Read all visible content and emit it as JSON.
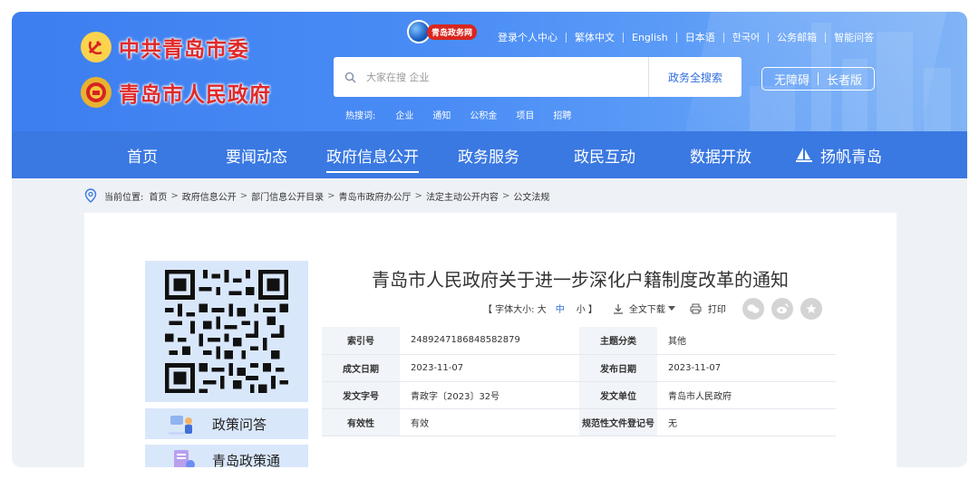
{
  "brand": {
    "party": "中共青岛市委",
    "government": "青岛市人民政府"
  },
  "portal_logo": "青岛政务网",
  "top_links": [
    "登录个人中心",
    "繁体中文",
    "English",
    "日本语",
    "한국어",
    "公务邮箱",
    "智能问答"
  ],
  "search": {
    "placeholder": "大家在搜 企业",
    "button": "政务全搜索"
  },
  "hot_search": {
    "label": "热搜词:",
    "items": [
      "企业",
      "通知",
      "公积金",
      "项目",
      "招聘"
    ]
  },
  "accessibility": {
    "barrier_free": "无障碍",
    "elder": "长者版"
  },
  "nav": [
    "首页",
    "要闻动态",
    "政府信息公开",
    "政务服务",
    "政民互动",
    "数据开放",
    "扬帆青岛"
  ],
  "nav_active": "政府信息公开",
  "breadcrumb": {
    "label": "当前位置:",
    "items": [
      "首页",
      "政府信息公开",
      "部门信息公开目录",
      "青岛市政府办公厅",
      "法定主动公开内容",
      "公文法规"
    ],
    "sep": ">"
  },
  "sidebar": [
    {
      "label": "政策问答",
      "icon": "qa-illustration-icon"
    },
    {
      "label": "青岛政策通",
      "icon": "policy-illustration-icon"
    }
  ],
  "article": {
    "title": "青岛市人民政府关于进一步深化户籍制度改革的通知",
    "font_size_label": "【 字体大小: 大",
    "font_mid": "中",
    "font_small": "小 】",
    "download": "全文下载",
    "print": "打印"
  },
  "meta": [
    {
      "k1": "索引号",
      "v1": "2489247186848582879",
      "k2": "主题分类",
      "v2": "其他"
    },
    {
      "k1": "成文日期",
      "v1": "2023-11-07",
      "k2": "发布日期",
      "v2": "2023-11-07"
    },
    {
      "k1": "发文字号",
      "v1": "青政字〔2023〕32号",
      "k2": "发文单位",
      "v2": "青岛市人民政府"
    },
    {
      "k1": "有效性",
      "v1": "有效",
      "k2": "规范性文件登记号",
      "v2": "无"
    }
  ],
  "colors": {
    "nav_bg": "#3a78e2",
    "header": "#4a8cf5",
    "brand_red": "#e02a2a",
    "link_blue": "#2e6bd6"
  }
}
